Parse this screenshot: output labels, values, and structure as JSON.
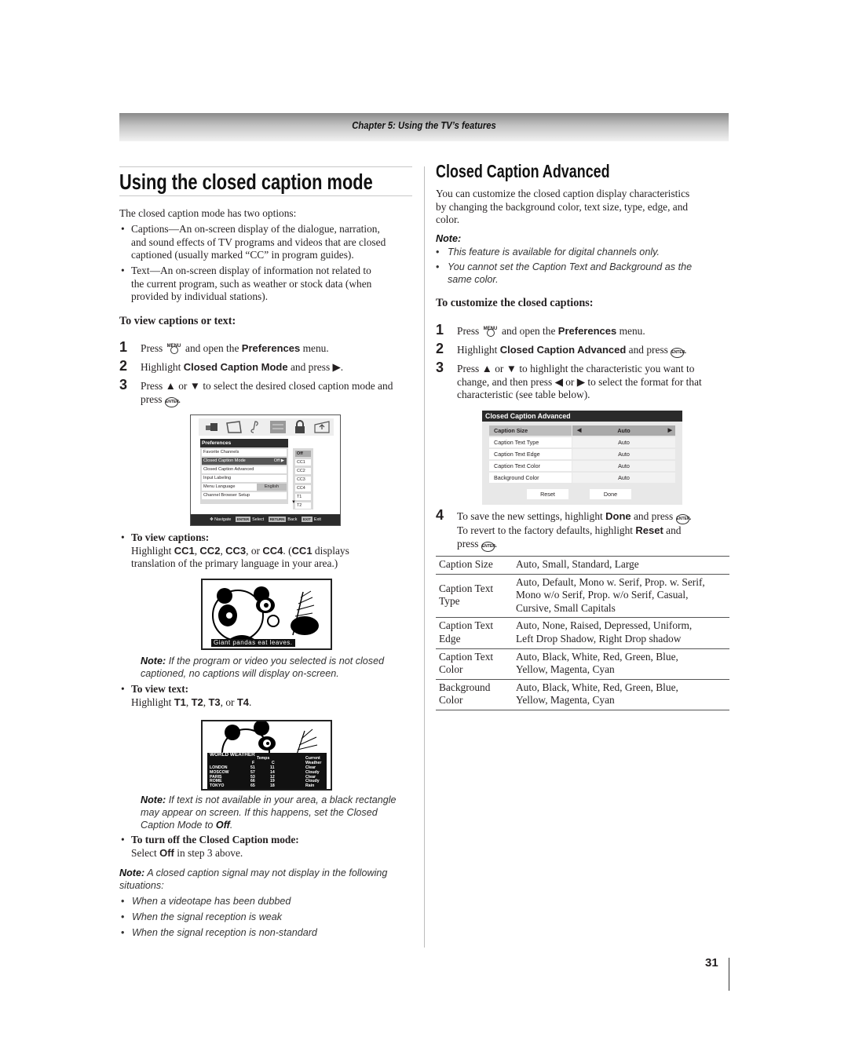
{
  "header": {
    "chapter": "Chapter 5: Using the TV’s features"
  },
  "left": {
    "title": "Using the closed caption mode",
    "intro": "The closed caption mode has two options:",
    "options": [
      {
        "line1": "Captions—An on-screen display of the dialogue, narration,",
        "line2": "and sound effects of TV programs and videos that are closed",
        "line3": "captioned (usually marked “CC” in program guides)."
      },
      {
        "line1": "Text—An on-screen display of information not related to",
        "line2": "the current program, such as weather or stock data (when",
        "line3": "provided by individual stations)."
      }
    ],
    "subheading": "To view captions or text:",
    "steps": [
      {
        "num": "1",
        "pre": "Press",
        "icon": "menu-button-icon",
        "mid": "and open the",
        "bold": "Preferences",
        "post": "menu."
      },
      {
        "num": "2",
        "pre": "Highlight",
        "bold": "Closed Caption Mode",
        "post": "and press ▶."
      },
      {
        "num": "3",
        "line1": "Press ▲ or ▼ to select the desired closed caption mode and",
        "line2": "press",
        "post": "."
      }
    ],
    "pref_screen": {
      "panel_title": "Preferences",
      "rows": [
        {
          "label": "Favorite Channels",
          "value": ""
        },
        {
          "label": "Closed Caption Mode",
          "value": "Off ▶"
        },
        {
          "label": "Closed Caption Advanced",
          "value": ""
        },
        {
          "label": "Input Labeling",
          "value": ""
        },
        {
          "label": "Menu Language",
          "value": "English"
        },
        {
          "label": "Channel Browser Setup",
          "value": ""
        }
      ],
      "cc_options": [
        "Off",
        "CC1",
        "CC2",
        "CC3",
        "CC4",
        "T1",
        "T2"
      ],
      "selected_cc": "Off",
      "footer": {
        "navigate": "Navigate",
        "enter_key": "ENTER",
        "select": "Select",
        "return_key": "RETURN",
        "back": "Back",
        "exit_key": "EXIT",
        "exit": "Exit"
      }
    },
    "view_captions": {
      "heading": "To view captions:",
      "line1_pre": "Highlight",
      "cc1": "CC1",
      "cc2": "CC2",
      "cc3": "CC3",
      "or": "or",
      "cc4": "CC4",
      "paren_open": ". (",
      "cc1b": "CC1",
      "line1_post": "displays",
      "line2": "translation of the primary language in your area.)"
    },
    "caption_sample": "Giant  pandas  eat  leaves.",
    "note1": {
      "label": "Note:",
      "line1": "If the program or video you selected is not closed",
      "line2": "captioned, no captions will display on-screen."
    },
    "view_text": {
      "heading": "To view text:",
      "pre": "Highlight",
      "t1": "T1",
      "t2": "T2",
      "t3": "T3",
      "or": "or",
      "t4": "T4"
    },
    "weather": {
      "title": "WORLD WEATHER",
      "temps_label": "Temps",
      "current_label": "Current",
      "weather_label": "Weather",
      "f_label": "F",
      "c_label": "C",
      "rows": [
        {
          "city": "LONDON",
          "f": "51",
          "c": "11",
          "cond": "Clear"
        },
        {
          "city": "MOSCOW",
          "f": "57",
          "c": "14",
          "cond": "Cloudy"
        },
        {
          "city": "PARIS",
          "f": "53",
          "c": "12",
          "cond": "Clear"
        },
        {
          "city": "ROME",
          "f": "66",
          "c": "19",
          "cond": "Cloudy"
        },
        {
          "city": "TOKYO",
          "f": "65",
          "c": "18",
          "cond": "Rain"
        }
      ]
    },
    "note2": {
      "label": "Note:",
      "line1": "If text is not available in your area, a black rectangle",
      "line2": "may appear on screen. If this happens, set the Closed",
      "line3": "Caption Mode to",
      "off": "Off",
      "end": "."
    },
    "turn_off": {
      "heading": "To turn off the Closed Caption mode:",
      "pre": "Select",
      "off": "Off",
      "post": "in step 3 above."
    },
    "note3": {
      "label": "Note:",
      "line1": "A closed caption signal may not display in the following",
      "line2": "situations:",
      "items": [
        "When a videotape has been dubbed",
        "When the signal reception is weak",
        "When the signal reception is non-standard"
      ]
    }
  },
  "right": {
    "title": "Closed Caption Advanced",
    "intro": {
      "line1": "You can customize the closed caption display characteristics",
      "line2": "by changing the background color, text size, type, edge, and",
      "line3": "color."
    },
    "note": {
      "label": "Note:",
      "items": [
        {
          "line1": "This feature is available for digital channels only."
        },
        {
          "line1": "You cannot set the Caption Text and Background as the",
          "line2": "same color."
        }
      ]
    },
    "subheading": "To customize the closed captions:",
    "steps": [
      {
        "num": "1",
        "pre": "Press",
        "mid": "and open the",
        "bold": "Preferences",
        "post": "menu."
      },
      {
        "num": "2",
        "pre": "Highlight",
        "bold": "Closed Caption Advanced",
        "post": "and press",
        "end": "."
      },
      {
        "num": "3",
        "line1": "Press ▲ or ▼ to highlight the characteristic you want to",
        "line2": "change, and then press ◀ or ▶ to select the format for that",
        "line3": "characteristic (see table below)."
      },
      {
        "num": "4",
        "l1_pre": "To save the new settings, highlight",
        "l1_bold": "Done",
        "l1_post": "and press",
        "l2_pre": "To revert to the factory defaults, highlight",
        "l2_bold": "Reset",
        "l2_post": "and",
        "l3": "press"
      }
    ],
    "cca_screen": {
      "title": "Closed Caption Advanced",
      "rows": [
        {
          "label": "Caption Size",
          "value": "Auto"
        },
        {
          "label": "Caption Text Type",
          "value": "Auto"
        },
        {
          "label": "Caption Text Edge",
          "value": "Auto"
        },
        {
          "label": "Caption Text Color",
          "value": "Auto"
        },
        {
          "label": "Background Color",
          "value": "Auto"
        }
      ],
      "reset": "Reset",
      "done": "Done"
    },
    "options_table": [
      {
        "k1": "Caption Size",
        "k2": "",
        "v": [
          "Auto, Small, Standard, Large"
        ]
      },
      {
        "k1": "Caption Text",
        "k2": "Type",
        "v": [
          "Auto, Default, Mono w. Serif, Prop. w. Serif,",
          "Mono w/o Serif, Prop. w/o Serif, Casual,",
          "Cursive, Small Capitals"
        ]
      },
      {
        "k1": "Caption Text",
        "k2": "Edge",
        "v": [
          "Auto, None, Raised, Depressed, Uniform,",
          "Left Drop Shadow, Right Drop shadow"
        ]
      },
      {
        "k1": "Caption Text",
        "k2": "Color",
        "v": [
          "Auto, Black, White, Red, Green, Blue,",
          "Yellow, Magenta, Cyan"
        ]
      },
      {
        "k1": "Background",
        "k2": "Color",
        "v": [
          "Auto, Black, White, Red, Green, Blue,",
          "Yellow, Magenta, Cyan"
        ]
      }
    ]
  },
  "page_number": "31",
  "icons": {
    "menu": "MENU",
    "enter": "ENTER"
  }
}
